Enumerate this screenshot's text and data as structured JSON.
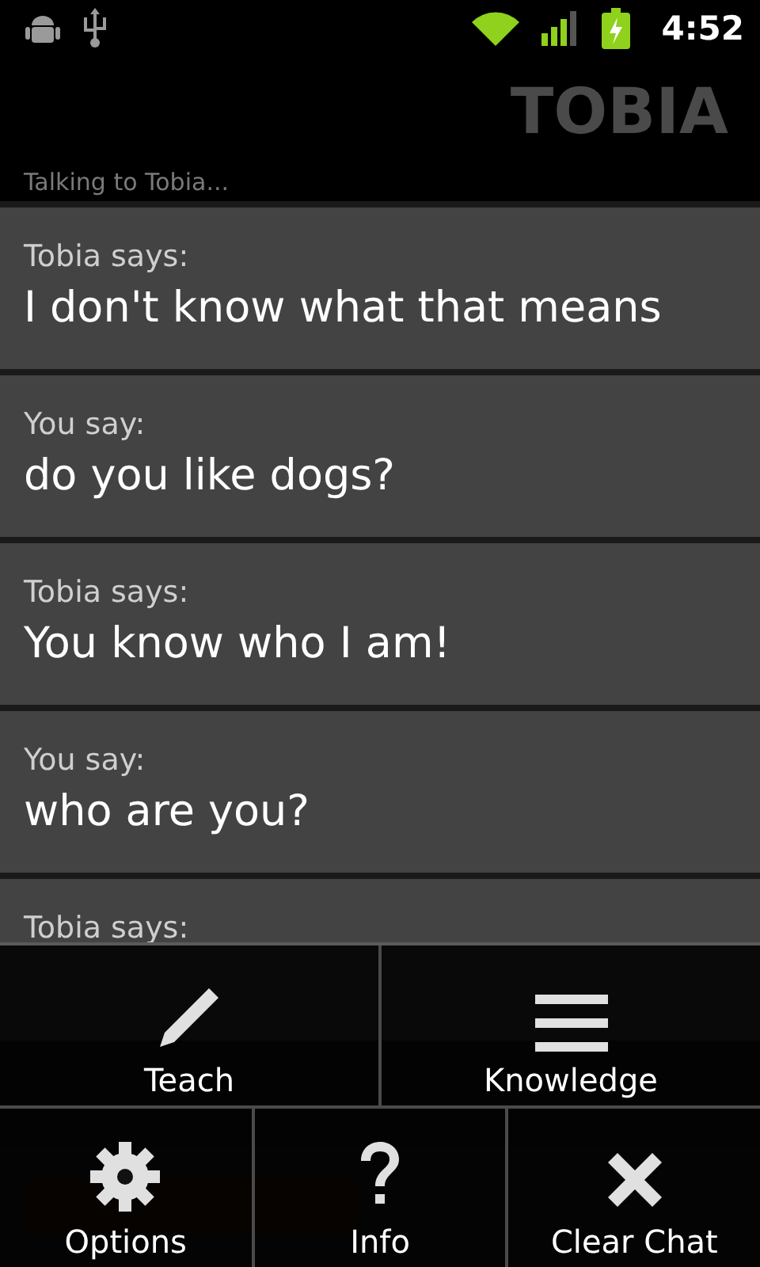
{
  "status_bar": {
    "time": "4:52"
  },
  "title": "TOBIA",
  "subtitle": "Talking to Tobia...",
  "messages": [
    {
      "sender": "Tobia says:",
      "text": "I don't know what that means"
    },
    {
      "sender": "You say:",
      "text": "do you like dogs?"
    },
    {
      "sender": "Tobia says:",
      "text": "You know who I am!"
    },
    {
      "sender": "You say:",
      "text": "who are you?"
    },
    {
      "sender": "Tobia says:"
    }
  ],
  "menu": {
    "upper_items": [
      {
        "label": "Teach"
      },
      {
        "label": "Knowledge"
      }
    ],
    "lower_items": [
      {
        "label": "Options"
      },
      {
        "label": "Info"
      },
      {
        "label": "Clear Chat"
      }
    ]
  }
}
